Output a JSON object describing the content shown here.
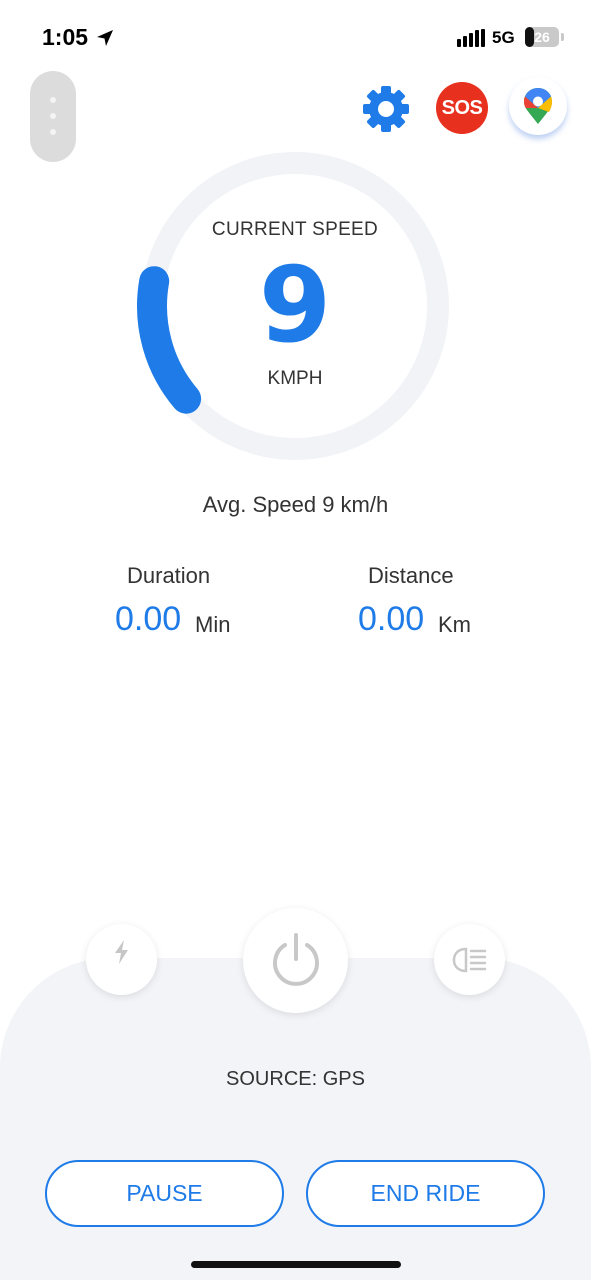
{
  "status_bar": {
    "time": "1:05",
    "network": "5G",
    "battery": "26",
    "battery_level": 0.26,
    "location_icon": "location-arrow-icon",
    "signal_icon": "signal-bars-icon"
  },
  "header": {
    "menu_icon": "more-vertical-icon",
    "settings_icon": "gear-icon",
    "sos_label": "SOS",
    "maps_icon": "google-maps-pin-icon"
  },
  "speedometer": {
    "label": "CURRENT SPEED",
    "value": "9",
    "unit": "KMPH",
    "fill_fraction": 0.14
  },
  "avg_speed": "Avg. Speed 9 km/h",
  "stats": {
    "duration_label": "Duration",
    "duration_value": "0.00",
    "duration_unit": "Min",
    "distance_label": "Distance",
    "distance_value": "0.00",
    "distance_unit": "Km"
  },
  "controls": {
    "flash_icon": "lightning-bolt-icon",
    "power_icon": "power-icon",
    "headlight_icon": "headlight-icon"
  },
  "source": "SOURCE: GPS",
  "buttons": {
    "pause": "PAUSE",
    "end_ride": "END RIDE"
  },
  "colors": {
    "accent": "#1e7be8",
    "sos": "#e8301f",
    "panel": "#f3f4f8"
  }
}
